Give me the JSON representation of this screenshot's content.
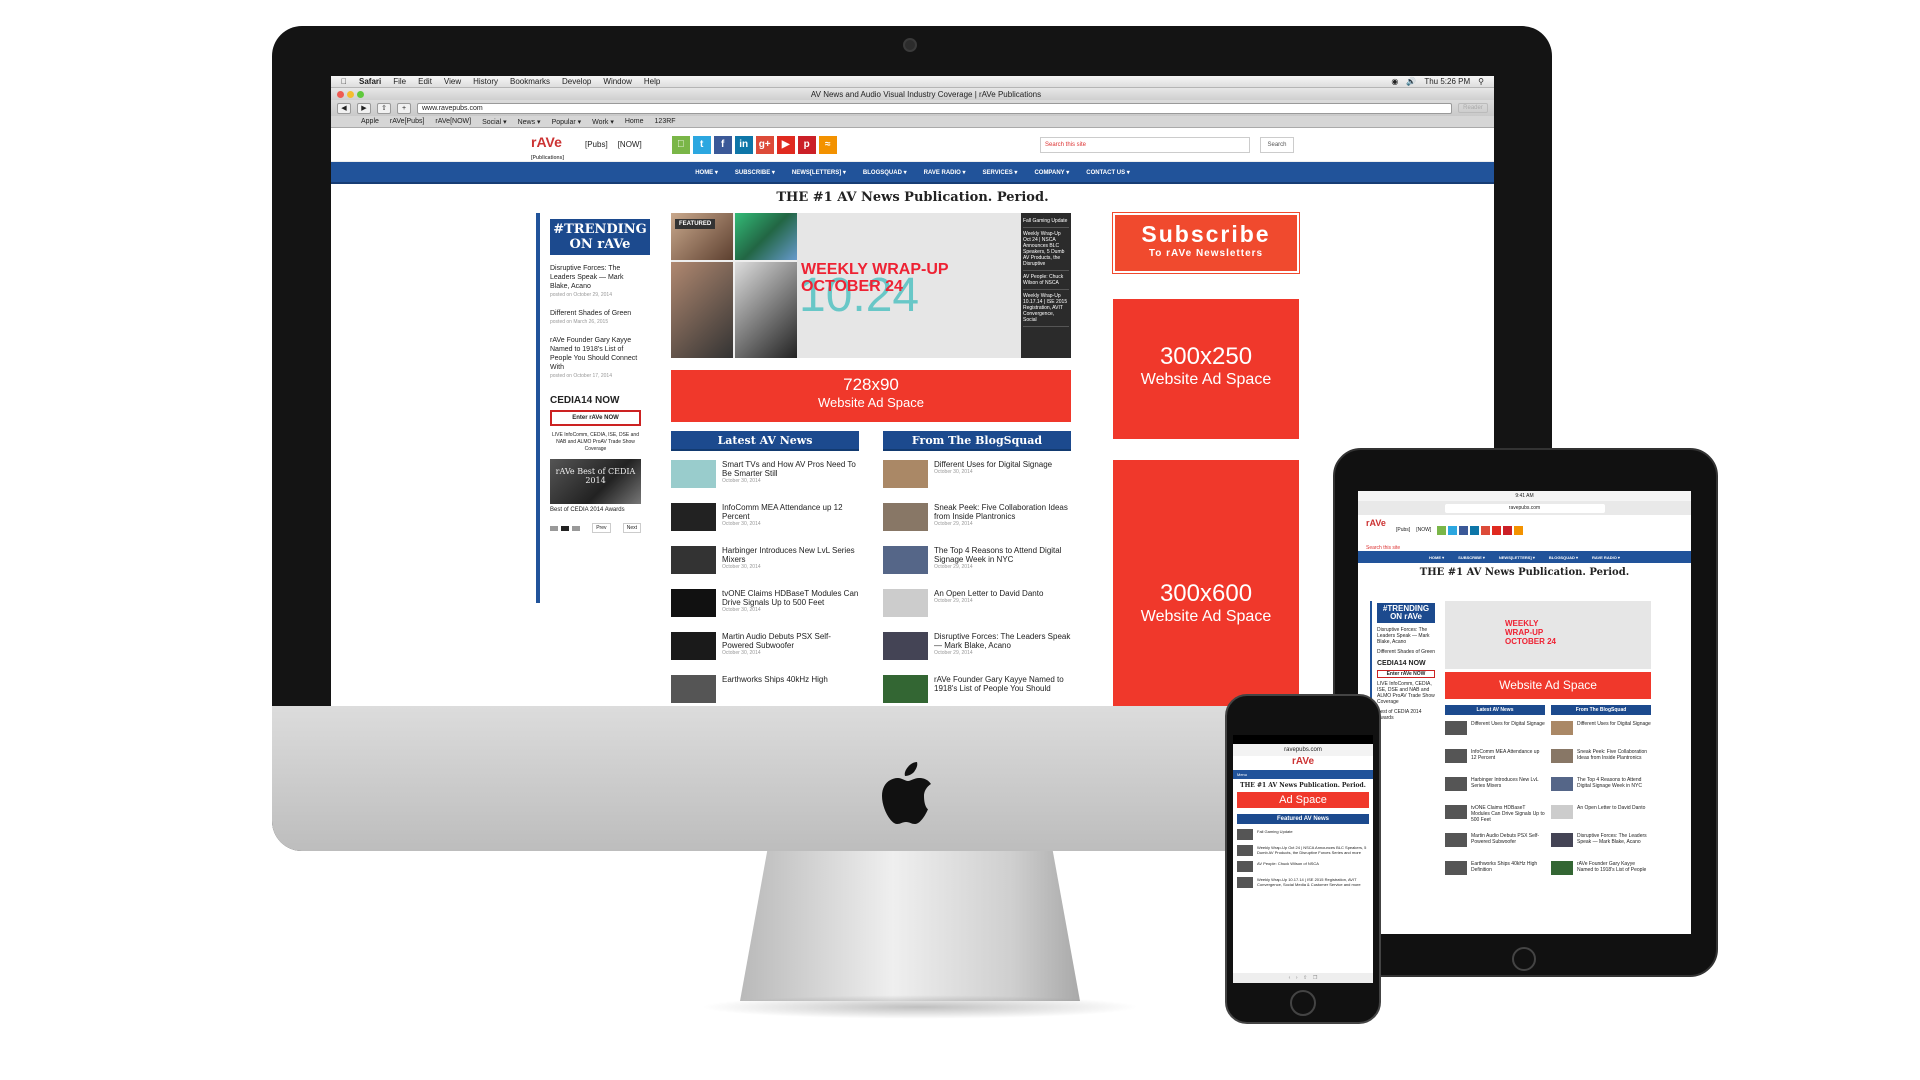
{
  "mac": {
    "menubar": [
      "Safari",
      "File",
      "Edit",
      "View",
      "History",
      "Bookmarks",
      "Develop",
      "Window",
      "Help"
    ],
    "clock": "Thu 5:26 PM",
    "window_title": "AV News and Audio Visual Industry Coverage | rAVe Publications",
    "url": "www.ravepubs.com",
    "reader": "Reader",
    "bookmarks": [
      "Apple",
      "rAVe[Pubs]",
      "rAVe[NOW]",
      "Social ▾",
      "News ▾",
      "Popular ▾",
      "Work ▾",
      "Home",
      "123RF"
    ]
  },
  "site": {
    "logo": "rAVe",
    "logo_sub": "[Publications]",
    "pubs": "[Pubs]",
    "now": "[NOW]",
    "search_placeholder": "Search this site",
    "search_button": "Search",
    "nav": [
      "HOME ▾",
      "SUBSCRIBE ▾",
      "NEWS[LETTERS] ▾",
      "BLOGSQUAD ▾",
      "RAVE RADIO ▾",
      "SERVICES ▾",
      "COMPANY ▾",
      "CONTACT US ▾"
    ],
    "tagline": "THE #1 AV News Publication. Period.",
    "trending": "#TRENDING ON rAVe",
    "trending_items": [
      {
        "title": "Disruptive Forces: The Leaders Speak — Mark Blake, Acano",
        "date": "posted on October 29, 2014"
      },
      {
        "title": "Different Shades of Green",
        "date": "posted on March 26, 2015"
      },
      {
        "title": "rAVe Founder Gary Kayye Named to 1918's List of People You Should Connect With",
        "date": "posted on October 17, 2014"
      }
    ],
    "cedia_title": "CEDIA14 NOW",
    "enter_now": "Enter rAVe NOW",
    "cedia_desc": "LIVE InfoComm, CEDIA, ISE, DSE and NAB and ALMO ProAV Trade Show Coverage",
    "award_text": "rAVe Best of CEDIA 2014",
    "award_caption": "Best of CEDIA 2014 Awards",
    "prev": "Prev",
    "next": "Next",
    "featured_label": "FEATURED",
    "wrap_title": "WEEKLY WRAP-UP OCTOBER 24",
    "wrap_number": "10.24",
    "featured_list": [
      "Fall Gaming Update",
      "Weekly Wrap-Up Oct 24 | NSCA Announces BLC Speakers, 5 Dumb AV Products, the Disruptive",
      "AV People: Chuck Wilson of NSCA",
      "Weekly Wrap-Up 10.17.14 | ISE 2015 Registration, AVIT Convergence, Social"
    ],
    "ad728_size": "728x90",
    "ad_label": "Website Ad Space",
    "latest_head": "Latest AV News",
    "latest": [
      {
        "title": "Smart TVs and How AV Pros Need To Be Smarter Still",
        "date": "October 30, 2014"
      },
      {
        "title": "InfoComm MEA Attendance up 12 Percent",
        "date": "October 30, 2014"
      },
      {
        "title": "Harbinger Introduces New LvL Series Mixers",
        "date": "October 30, 2014"
      },
      {
        "title": "tvONE Claims HDBaseT Modules Can Drive Signals Up to 500 Feet",
        "date": "October 30, 2014"
      },
      {
        "title": "Martin Audio Debuts PSX Self-Powered Subwoofer",
        "date": "October 30, 2014"
      },
      {
        "title": "Earthworks Ships 40kHz High",
        "date": ""
      }
    ],
    "blog_head": "From The BlogSquad",
    "blog": [
      {
        "title": "Different Uses for Digital Signage",
        "date": "October 30, 2014"
      },
      {
        "title": "Sneak Peek: Five Collaboration Ideas from Inside Plantronics",
        "date": "October 29, 2014"
      },
      {
        "title": "The Top 4 Reasons to Attend Digital Signage Week in NYC",
        "date": "October 29, 2014"
      },
      {
        "title": "An Open Letter to David Danto",
        "date": "October 29, 2014"
      },
      {
        "title": "Disruptive Forces: The Leaders Speak — Mark Blake, Acano",
        "date": "October 29, 2014"
      },
      {
        "title": "rAVe Founder Gary Kayye Named to 1918's List of People You Should",
        "date": ""
      }
    ],
    "subscribe": "Subscribe",
    "subscribe_sub": "To rAVe Newsletters",
    "ad300x250": "300x250",
    "ad300x600": "300x600"
  },
  "ipad": {
    "status": "9:41 AM",
    "url": "ravepubs.com",
    "search_placeholder": "Search this site",
    "ad": "Website Ad Space",
    "latest_head": "Latest AV News",
    "blog_head": "From The BlogSquad",
    "latest": [
      "Different Uses for Digital Signage",
      "InfoComm MEA Attendance up 12 Percent",
      "Harbinger Introduces New LvL Series Mixers",
      "tvONE Claims HDBaseT Modules Can Drive Signals Up to 500 Feet",
      "Martin Audio Debuts PSX Self-Powered Subwoofer",
      "Earthworks Ships 40kHz High Definition"
    ],
    "blog": [
      "Different Uses for Digital Signage",
      "Sneak Peek: Five Collaboration Ideas from Inside Plantronics",
      "The Top 4 Reasons to Attend Digital Signage Week in NYC",
      "An Open Letter to David Danto",
      "Disruptive Forces: The Leaders Speak — Mark Blake, Acano",
      "rAVe Founder Gary Kayye Named to 1918's List of People"
    ]
  },
  "iphone": {
    "url": "ravepubs.com",
    "menu": "Menu",
    "ad": "Ad Space",
    "featured_head": "Featured AV News",
    "items": [
      "Fall Gaming Update",
      "Weekly Wrap-Up Oct 24 | NSCA Announces BLC Speakers, 5 Dumb AV Products, the Disruptive Forces Series and more",
      "AV People: Chuck Wilson of NSCA",
      "Weekly Wrap-Up 10.17.14 | ISE 2015 Registration, AVIT Convergence, Social Media & Customer Service and more"
    ]
  },
  "colors": {
    "brand_blue": "#21539a",
    "ad_red": "#f0382b",
    "subscribe_orange": "#f04a2e"
  },
  "icons": [
    "apple-logo-icon",
    "facebook-icon",
    "twitter-icon",
    "linkedin-icon",
    "google-plus-icon",
    "youtube-icon",
    "pinterest-icon",
    "rss-icon"
  ]
}
